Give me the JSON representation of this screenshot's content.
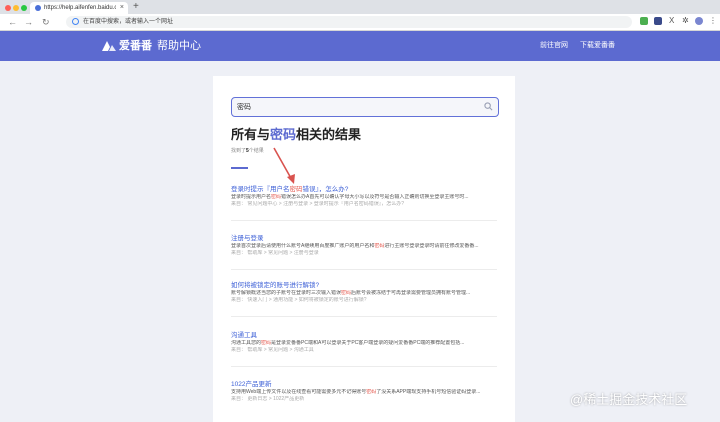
{
  "browser": {
    "tab_title": "https://help.aifenfen.baidu.com",
    "tab_close": "×",
    "new_tab": "+",
    "back": "←",
    "forward": "→",
    "reload": "↻",
    "omnibox_text": "在百度中搜索，或者输入一个网址",
    "puzzle_glyph": "✲",
    "x_glyph": "X"
  },
  "site": {
    "logo_text": "爱番番",
    "logo_sub": "帮助中心",
    "nav": [
      "前往官网",
      "下载爱番番"
    ]
  },
  "search": {
    "value": "密码"
  },
  "results_heading": {
    "prefix": "所有与",
    "keyword": "密码",
    "suffix": "相关的结果"
  },
  "result_count": {
    "prefix": "找到了",
    "number": "5",
    "suffix": "个结果"
  },
  "results": [
    {
      "title_a": "登录时提示『用户名",
      "title_hl": "密码",
      "title_b": "错误』，怎么办?",
      "snippet_a": "登录时提示用户名",
      "snippet_hl": "密码",
      "snippet_b": "错误怎么办A首先可以确认字母大小写以及符号是否输入正确则切换至登录主账号时...",
      "meta": "来自： 常见问题中心 > 注册与登录 > 登录时提示『用户名密码错误』，怎么办?"
    },
    {
      "title_a": "注册与登录",
      "title_hl": "",
      "title_b": "",
      "snippet_a": "登录首次登录后请使用什么账号A继续用百度推广账户的用户名和",
      "snippet_hl": "密码",
      "snippet_b": "进行主账号登录登录时请前往修改爱番番...",
      "meta": "来自： 帮助库 > 常见问题 > 注册与登录"
    },
    {
      "title_a": "如何将被锁定的账号进行解锁?",
      "title_hl": "",
      "title_b": "",
      "snippet_a": "账号解锁概述当您的子账号在登录时三次输入错误",
      "snippet_hl": "密码",
      "snippet_b": "后账号会被冻结于可再登录需要管理员拥有账号管理...",
      "meta": "来自： 快速入门 > 通用功能 > 如何将被锁定的账号进行解锁?"
    },
    {
      "title_a": "沟通工具",
      "title_hl": "",
      "title_b": "",
      "snippet_a": "沟通工具您的",
      "snippet_hl": "密码",
      "snippet_b": "是登录爱番番PC端和A可以登录关于PC客户端登录的疑问爱番番PC端的推荐配置包括...",
      "meta": "来自： 帮助库 > 常见问题 > 沟通工具"
    },
    {
      "title_a": "1022产品更新",
      "title_hl": "",
      "title_b": "",
      "snippet_a": "支持用Web端上传文件以及在线查看可能需要多元不记得账号",
      "snippet_hl": "密码",
      "snippet_b": "了没关系APP端现支持手机号短信验证码登录...",
      "meta": "来自： 更新日志 > 1022产品更新"
    }
  ],
  "watermark": "@稀土掘金技术社区",
  "colors": {
    "brand": "#5c6ad0",
    "link": "#3c5fd6",
    "highlight": "#e4574c",
    "arrow": "#d9534f"
  }
}
